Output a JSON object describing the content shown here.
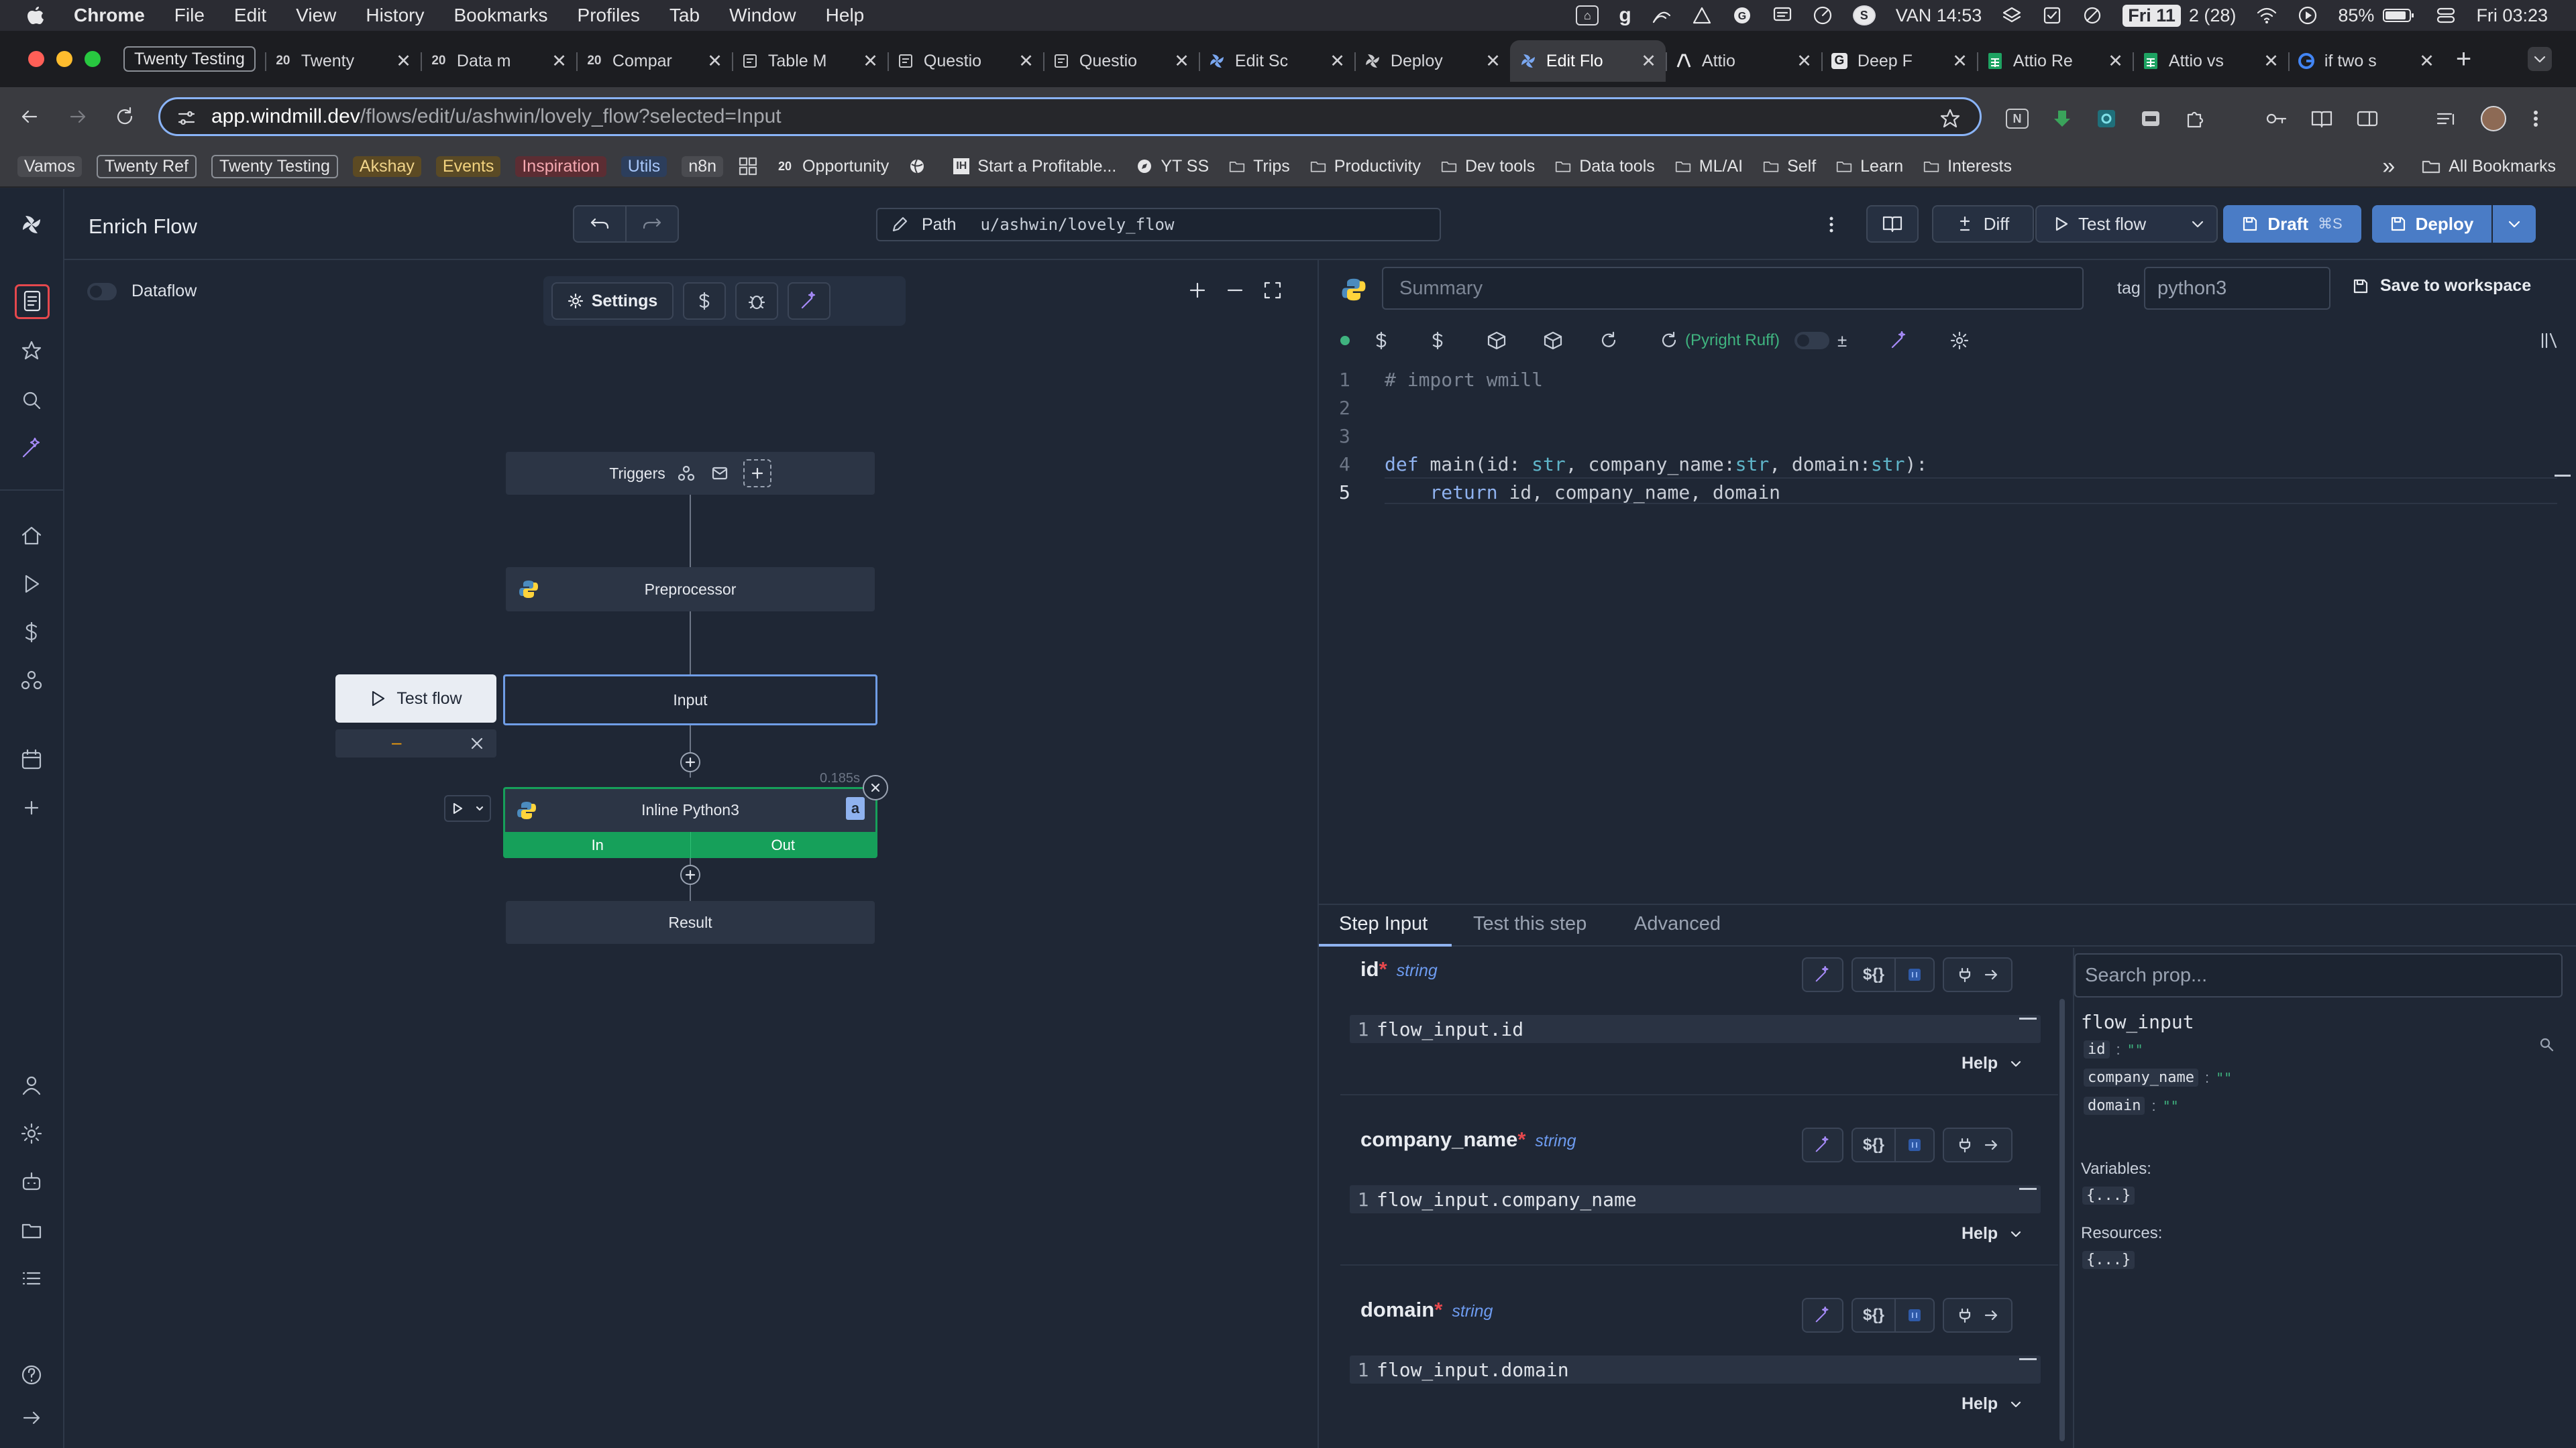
{
  "menubar": {
    "items": [
      "Chrome",
      "File",
      "Edit",
      "View",
      "History",
      "Bookmarks",
      "Profiles",
      "Tab",
      "Window",
      "Help"
    ],
    "status_g": "g",
    "status_s": "S",
    "location_time": "VAN 14:53",
    "date_badge": "Fri 11",
    "date_count": "2 (28)",
    "battery": "85%",
    "clock": "Fri 03:23"
  },
  "tabs": {
    "group_label": "Twenty Testing",
    "items": [
      {
        "title": "Twenty",
        "icon": "20"
      },
      {
        "title": "Data m",
        "icon": "20"
      },
      {
        "title": "Compar",
        "icon": "20"
      },
      {
        "title": "Table M",
        "icon": "doc"
      },
      {
        "title": "Questio",
        "icon": "doc"
      },
      {
        "title": "Questio",
        "icon": "doc"
      },
      {
        "title": "Edit Sc",
        "icon": "windmill"
      },
      {
        "title": "Deploy",
        "icon": "windmill-grey"
      },
      {
        "title": "Edit Flo",
        "icon": "windmill",
        "active": true
      },
      {
        "title": "Attio",
        "icon": "attio"
      },
      {
        "title": "Deep F",
        "icon": "g"
      },
      {
        "title": "Attio Re",
        "icon": "sheets"
      },
      {
        "title": "Attio vs",
        "icon": "sheets"
      },
      {
        "title": "if two s",
        "icon": "google"
      }
    ]
  },
  "address": {
    "host": "app.windmill.dev",
    "path": "/flows/edit/u/ashwin/lovely_flow?selected=Input"
  },
  "bookmarks": {
    "pills": [
      {
        "label": "Vamos",
        "bg": "#4a4b50",
        "fg": "#e6e6e8"
      },
      {
        "label": "Twenty Ref",
        "bg": "transparent",
        "fg": "#e6e6e8",
        "border": true
      },
      {
        "label": "Twenty Testing",
        "bg": "transparent",
        "fg": "#e6e6e8",
        "border": true
      },
      {
        "label": "Akshay",
        "bg": "#5c4a23",
        "fg": "#f0d48a"
      },
      {
        "label": "Events",
        "bg": "#5a4a25",
        "fg": "#f2d27e"
      },
      {
        "label": "Inspiration",
        "bg": "#5c2d33",
        "fg": "#f5a8b0"
      },
      {
        "label": "Utils",
        "bg": "#2c3e5c",
        "fg": "#a8c7fa"
      },
      {
        "label": "n8n",
        "bg": "#4a4b50",
        "fg": "#e6e6e8"
      }
    ],
    "links": [
      {
        "label": "Opportunity",
        "icon": "20"
      },
      {
        "label": "",
        "icon": "globe"
      },
      {
        "label": "Start a Profitable...",
        "icon": "ih"
      },
      {
        "label": "YT SS",
        "icon": "compass"
      },
      {
        "label": "Trips",
        "icon": "folder"
      },
      {
        "label": "Productivity",
        "icon": "folder"
      },
      {
        "label": "Dev tools",
        "icon": "folder"
      },
      {
        "label": "Data tools",
        "icon": "folder"
      },
      {
        "label": "ML/AI",
        "icon": "folder"
      },
      {
        "label": "Self",
        "icon": "folder"
      },
      {
        "label": "Learn",
        "icon": "folder"
      },
      {
        "label": "Interests",
        "icon": "folder"
      }
    ],
    "overflow": "»",
    "all_bookmarks": "All Bookmarks"
  },
  "header": {
    "title": "Enrich Flow",
    "path_label": "Path",
    "path_value": "u/ashwin/lovely_flow",
    "diff_label": "Diff",
    "test_flow_label": "Test flow",
    "draft_label": "Draft",
    "draft_shortcut": "⌘S",
    "deploy_label": "Deploy"
  },
  "canvas": {
    "dataflow_label": "Dataflow",
    "settings_label": "Settings",
    "triggers_label": "Triggers",
    "preprocessor_label": "Preprocessor",
    "input_label": "Input",
    "test_flow_button": "Test flow",
    "step_dash": "–",
    "step_label": "Inline Python3",
    "step_badge": "a",
    "step_duration": "0.185s",
    "in_label": "In",
    "out_label": "Out",
    "result_label": "Result"
  },
  "editor": {
    "summary_placeholder": "Summary",
    "tag_label": "tag",
    "tag_value": "python3",
    "save_label": "Save to workspace",
    "linter_label": "(Pyright Ruff)",
    "plusminus": "±",
    "lines": [
      {
        "n": "1",
        "text": "# import wmill"
      },
      {
        "n": "2",
        "text": ""
      },
      {
        "n": "3",
        "text": ""
      },
      {
        "n": "4",
        "text": "def main(id: str, company_name:str, domain:str):"
      },
      {
        "n": "5",
        "text": "    return id, company_name, domain"
      }
    ]
  },
  "step_panel": {
    "tabs": [
      "Step Input",
      "Test this step",
      "Advanced"
    ],
    "fields": [
      {
        "name": "id",
        "type": "string",
        "expr_num": "1",
        "expr": "flow_input.id",
        "help": "Help"
      },
      {
        "name": "company_name",
        "type": "string",
        "expr_num": "1",
        "expr": "flow_input.company_name",
        "help": "Help"
      },
      {
        "name": "domain",
        "type": "string",
        "expr_num": "1",
        "expr": "flow_input.domain",
        "help": "Help"
      }
    ],
    "dollar_label": "${}",
    "search_placeholder": "Search prop...",
    "flow_input_title": "flow_input",
    "props": [
      {
        "key": "id",
        "value": "\"\""
      },
      {
        "key": "company_name",
        "value": "\"\""
      },
      {
        "key": "domain",
        "value": "\"\""
      }
    ],
    "variables_label": "Variables:",
    "variables_value": "{...}",
    "resources_label": "Resources:",
    "resources_value": "{...}"
  },
  "colors": {
    "accent_blue": "#4a7cc6",
    "step_green": "#16a05a",
    "highlight_red": "#e5484d",
    "linter_green": "#3fb37f"
  }
}
